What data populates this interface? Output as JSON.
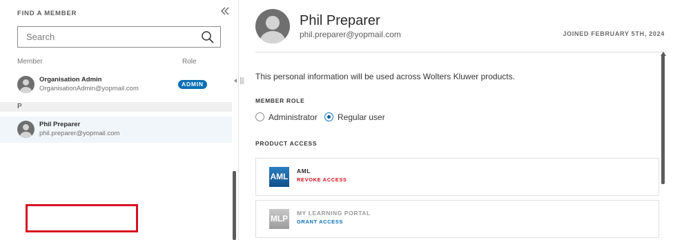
{
  "left": {
    "title": "FIND A MEMBER",
    "search_placeholder": "Search",
    "col_member": "Member",
    "col_role": "Role",
    "members": [
      {
        "name": "Organisation Admin",
        "email": "OrganisationAdmin@yopmail.com",
        "role_badge": "ADMIN"
      },
      {
        "name": "Phil Preparer",
        "email": "phil.preparer@yopmail.com"
      }
    ],
    "group_letter": "P"
  },
  "profile": {
    "name": "Phil Preparer",
    "email": "phil.preparer@yopmail.com",
    "joined": "JOINED FEBRUARY 5TH, 2024",
    "info_text": "This personal information will be used across Wolters Kluwer products.",
    "member_role_title": "MEMBER ROLE",
    "roles": [
      {
        "label": "Administrator",
        "selected": false
      },
      {
        "label": "Regular user",
        "selected": true
      }
    ],
    "product_access_title": "PRODUCT ACCESS",
    "products": [
      {
        "logo": "AML",
        "name": "AML",
        "action": "REVOKE ACCESS",
        "action_color": "#d7101f",
        "name_color": "#2b2b2b"
      },
      {
        "logo": "MLP",
        "name": "MY LEARNING PORTAL",
        "action": "GRANT ACCESS",
        "action_color": "#0a6fb3",
        "name_color": "#9a9a9a"
      }
    ]
  },
  "colors": {
    "accent": "#0a6fb3",
    "danger": "#d7101f",
    "highlight_box": "#d7101f"
  }
}
